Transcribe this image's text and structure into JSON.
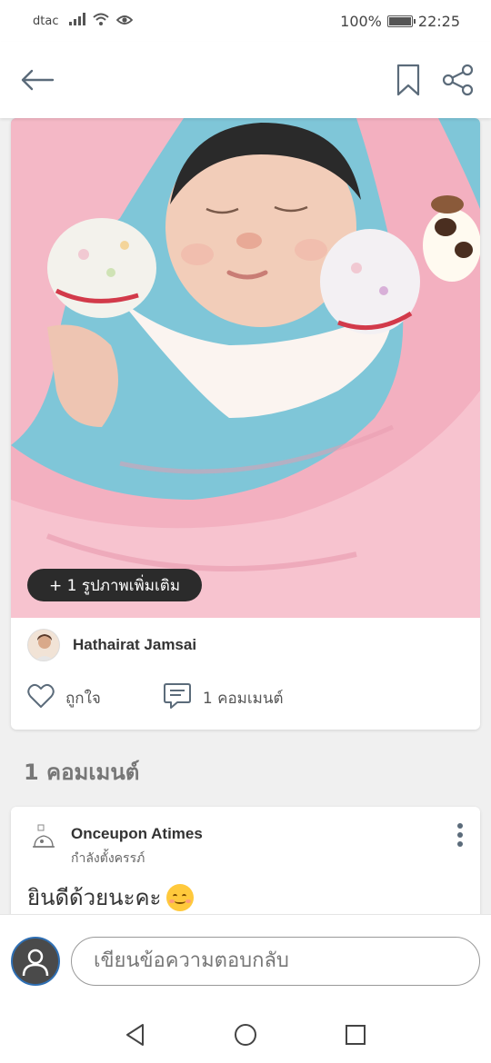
{
  "status_bar": {
    "carrier": "dtac",
    "battery_percent": "100%",
    "time": "22:25",
    "icons": [
      "signal-icon",
      "wifi-icon",
      "eye-icon",
      "battery-icon"
    ]
  },
  "app_bar": {
    "icons": [
      "back-arrow-icon",
      "bookmark-icon",
      "share-icon"
    ]
  },
  "post": {
    "more_photos_label": "+ 1 รูปภาพเพิ่มเติม",
    "author_name": "Hathairat Jamsai",
    "like_label": "ถูกใจ",
    "comment_count_label": "1 คอมเมนต์"
  },
  "comments_section": {
    "title": "1 คอมเมนต์",
    "items": [
      {
        "author": "Onceupon Atimes",
        "subtitle": "กำลังตั้งครรภ์",
        "text": "ยินดีด้วยนะคะ",
        "emoji": "smiling-face-emoji"
      }
    ]
  },
  "reply": {
    "placeholder": "เขียนข้อความตอบกลับ"
  },
  "nav_bar": {
    "icons": [
      "back-triangle-icon",
      "home-circle-icon",
      "recents-square-icon"
    ]
  },
  "colors": {
    "accent": "#5b6b7a",
    "pink_blanket": "#f3b4c4",
    "pill_bg": "#2b2b2b"
  }
}
